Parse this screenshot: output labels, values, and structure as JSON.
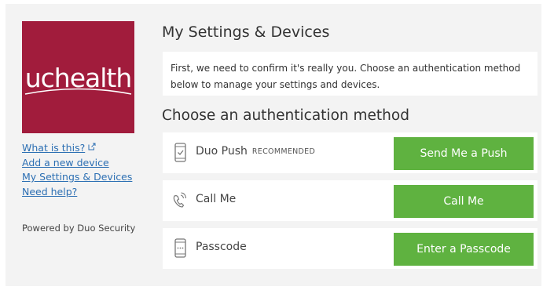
{
  "brand": {
    "logo_text": "uchealth",
    "logo_color": "#a11c3c"
  },
  "sidebar": {
    "links": [
      {
        "label": "What is this?",
        "icon": "external-link-icon"
      },
      {
        "label": "Add a new device"
      },
      {
        "label": "My Settings & Devices"
      },
      {
        "label": "Need help?"
      }
    ],
    "powered_by": "Powered by Duo Security"
  },
  "main": {
    "title": "My Settings & Devices",
    "intro": "First, we need to confirm it's really you. Choose an authentication method below to manage your settings and devices.",
    "methods_heading": "Choose an authentication method",
    "methods": [
      {
        "icon": "phone-check-icon",
        "label": "Duo Push",
        "badge": "RECOMMENDED",
        "button": "Send Me a Push"
      },
      {
        "icon": "phone-call-icon",
        "label": "Call Me",
        "badge": "",
        "button": "Call Me"
      },
      {
        "icon": "passcode-phone-icon",
        "label": "Passcode",
        "badge": "",
        "button": "Enter a Passcode"
      }
    ],
    "button_color": "#5fb240",
    "link_color": "#2c6fb3"
  }
}
